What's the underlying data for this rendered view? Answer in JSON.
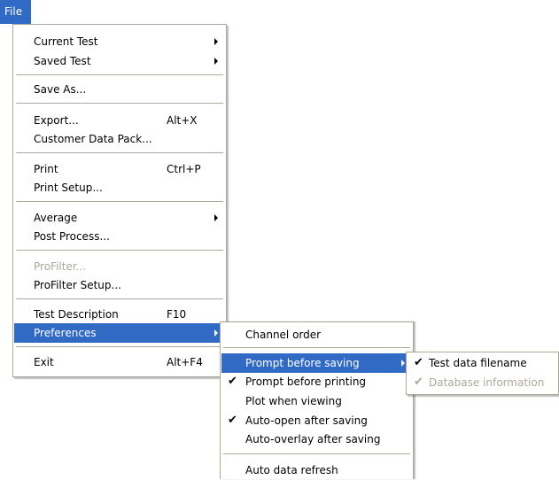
{
  "menubar": {
    "file_label": "File"
  },
  "file_menu": {
    "current_test": "Current Test",
    "saved_test": "Saved Test",
    "save_as": "Save As...",
    "export": "Export...",
    "export_shortcut": "Alt+X",
    "customer_data_pack": "Customer Data Pack...",
    "print": "Print",
    "print_shortcut": "Ctrl+P",
    "print_setup": "Print Setup...",
    "average": "Average",
    "post_process": "Post Process...",
    "profilter": "ProFilter...",
    "profilter_setup": "ProFilter Setup...",
    "test_description": "Test Description",
    "test_description_shortcut": "F10",
    "preferences": "Preferences",
    "exit": "Exit",
    "exit_shortcut": "Alt+F4"
  },
  "preferences_menu": {
    "channel_order": "Channel order",
    "prompt_before_saving": "Prompt before saving",
    "prompt_before_printing": "Prompt before printing",
    "plot_when_viewing": "Plot when viewing",
    "auto_open_after_saving": "Auto-open after saving",
    "auto_overlay_after_saving": "Auto-overlay after saving",
    "auto_data_refresh": "Auto data refresh",
    "checked": {
      "prompt_before_printing": true,
      "auto_open_after_saving": true
    }
  },
  "prompt_submenu": {
    "test_data_filename": "Test data filename",
    "database_information": "Database information",
    "checked": {
      "test_data_filename": true,
      "database_information": true
    }
  },
  "glyphs": {
    "check": "✔"
  },
  "colors": {
    "highlight": "#316ac5",
    "border": "#aca899",
    "disabled": "#aca899"
  }
}
